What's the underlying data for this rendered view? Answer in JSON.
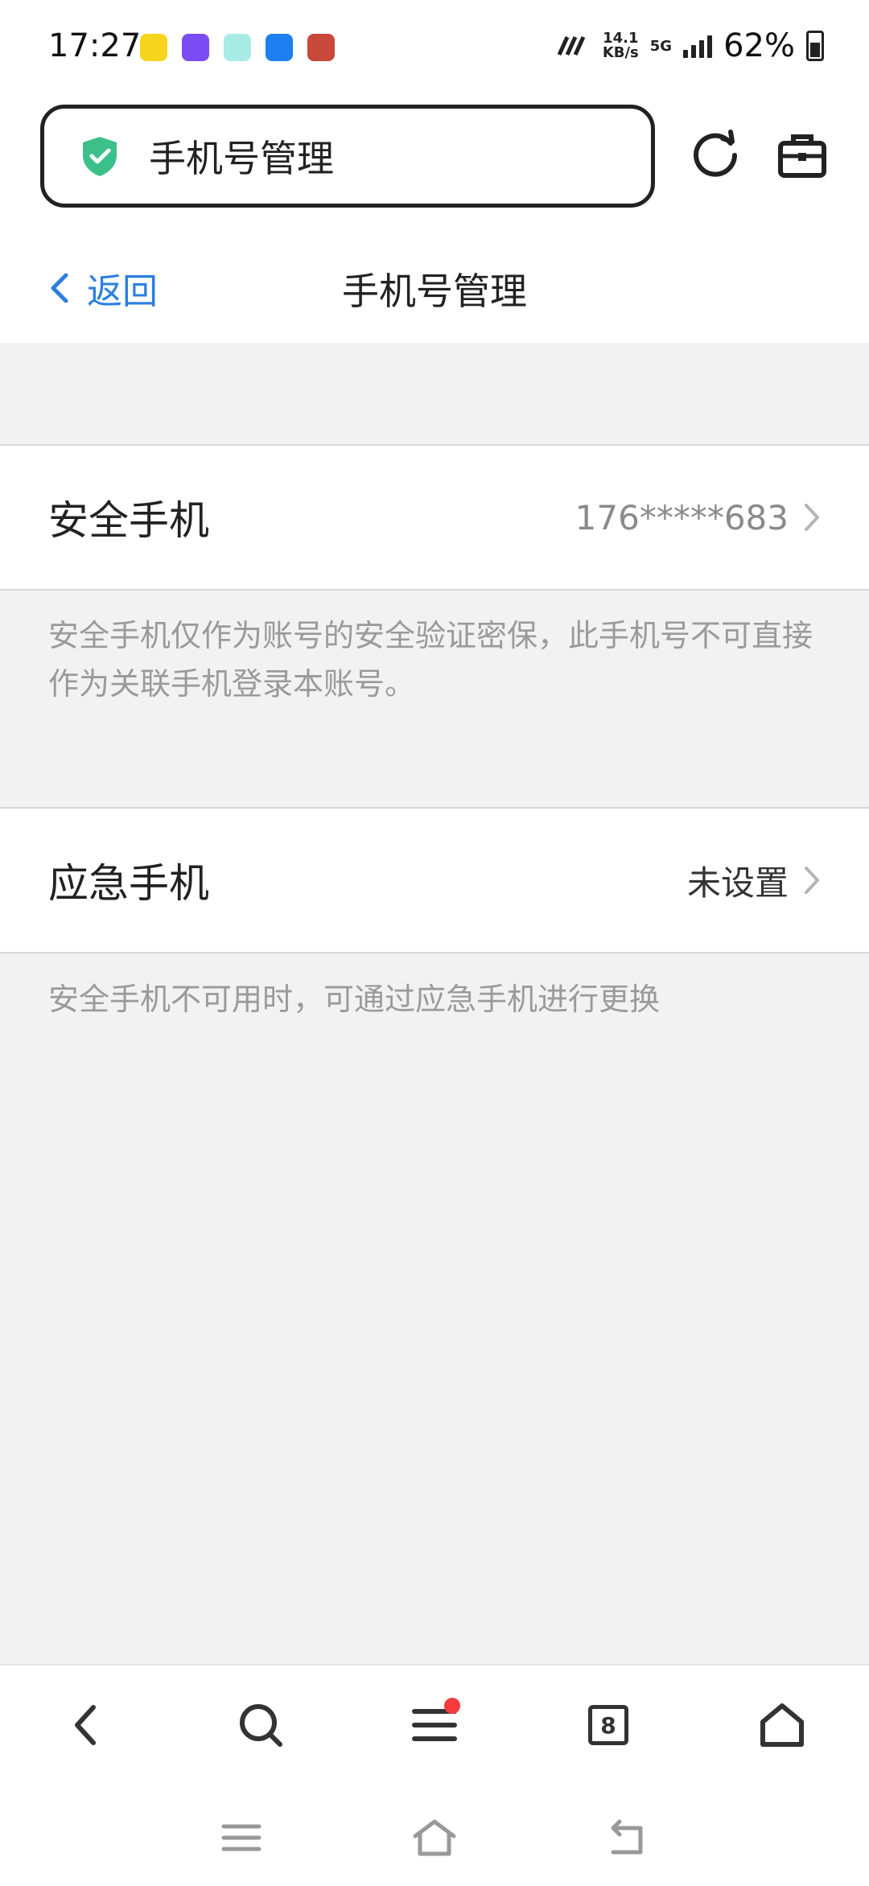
{
  "status_bar": {
    "time": "17:27",
    "net_speed_value": "14.1",
    "net_speed_unit": "KB/s",
    "network": "5G",
    "battery": "62%",
    "app_icon_colors": [
      "#f7d51c",
      "#7a4df2",
      "#7fe0d8",
      "#1e7ff0",
      "#c8483a"
    ]
  },
  "browser": {
    "url_text": "手机号管理",
    "icons": [
      "shield-check-icon",
      "refresh-icon",
      "toolbox-icon"
    ]
  },
  "page_header": {
    "back_label": "返回",
    "title": "手机号管理"
  },
  "sections": [
    {
      "label": "安全手机",
      "value": "176*****683",
      "description": "安全手机仅作为账号的安全验证密保，此手机号不可直接作为关联手机登录本账号。"
    },
    {
      "label": "应急手机",
      "value": "未设置",
      "description": "安全手机不可用时，可通过应急手机进行更换"
    }
  ],
  "bottom_toolbar": {
    "tab_count": "8",
    "icons": [
      "back-icon",
      "search-icon",
      "menu-icon",
      "tabs-icon",
      "home-icon"
    ]
  },
  "system_nav": {
    "icons": [
      "recent-apps-icon",
      "home-nav-icon",
      "back-nav-icon"
    ]
  },
  "colors": {
    "accent": "#2b7fe0",
    "shield": "#3cc08a",
    "notification": "#f23b3b"
  }
}
